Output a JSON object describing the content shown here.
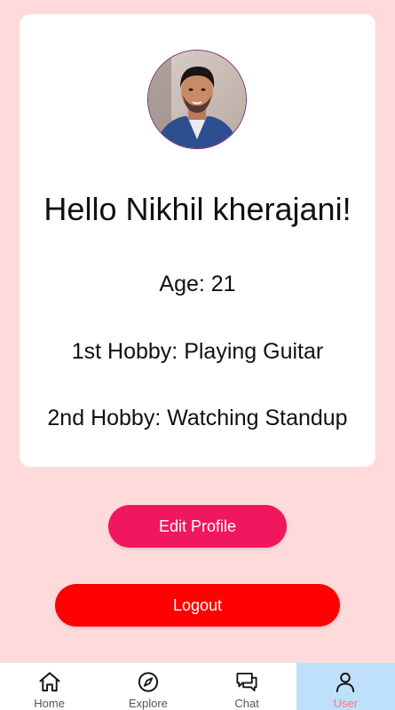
{
  "profile": {
    "greeting": "Hello Nikhil kherajani!",
    "age": "Age: 21",
    "hobby1": "1st Hobby: Playing Guitar",
    "hobby2": "2nd Hobby: Watching Standup"
  },
  "actions": {
    "edit_label": "Edit Profile",
    "logout_label": "Logout",
    "edit_color": "#f0175e",
    "logout_color": "#ff0000"
  },
  "nav": {
    "items": [
      {
        "label": "Home",
        "icon": "home-icon",
        "active": false
      },
      {
        "label": "Explore",
        "icon": "compass-icon",
        "active": false
      },
      {
        "label": "Chat",
        "icon": "chat-icon",
        "active": false
      },
      {
        "label": "User",
        "icon": "user-icon",
        "active": true
      }
    ],
    "active_color": "#bfe0fb",
    "active_label_color": "#f07a7a"
  },
  "colors": {
    "background": "#ffdadb",
    "card": "#ffffff"
  }
}
